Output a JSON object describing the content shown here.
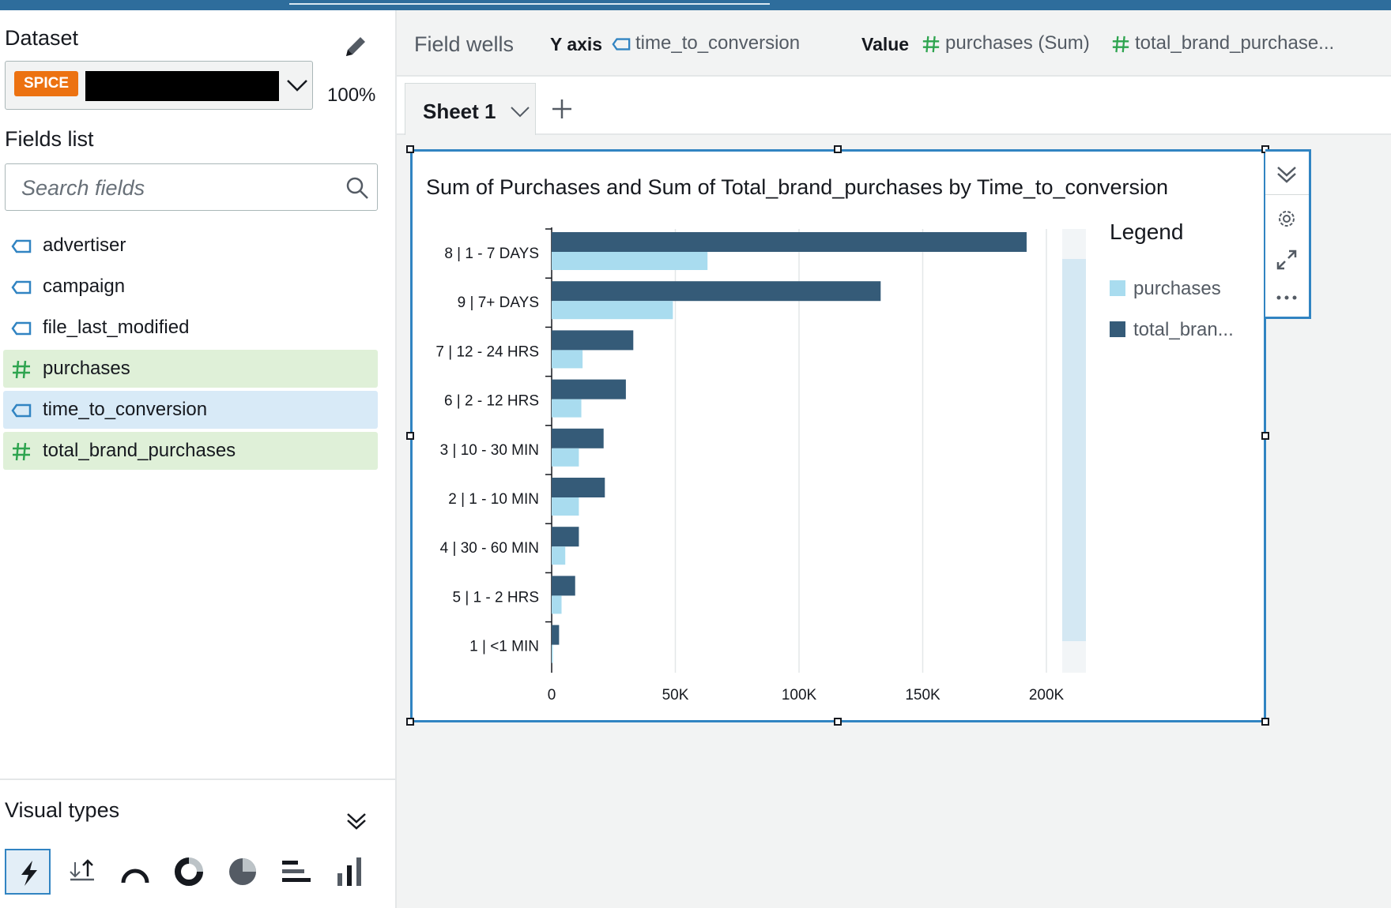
{
  "left": {
    "dataset_title": "Dataset",
    "dataset_badge": "SPICE",
    "dataset_percent": "100%",
    "fields_title": "Fields list",
    "search_placeholder": "Search fields",
    "fields": [
      {
        "label": "advertiser",
        "kind": "dimension"
      },
      {
        "label": "campaign",
        "kind": "dimension"
      },
      {
        "label": "file_last_modified",
        "kind": "dimension"
      },
      {
        "label": "purchases",
        "kind": "measure"
      },
      {
        "label": "time_to_conversion",
        "kind": "dimension-selected"
      },
      {
        "label": "total_brand_purchases",
        "kind": "measure"
      }
    ],
    "visual_types_title": "Visual types",
    "visual_type_icons": [
      "autograph-icon",
      "kpi-icon",
      "gauge-icon",
      "donut-icon",
      "pie-icon",
      "horizontal-bar-icon",
      "vertical-bar-icon"
    ]
  },
  "wells": {
    "title": "Field wells",
    "y_axis_label": "Y axis",
    "y_axis_field": "time_to_conversion",
    "value_label": "Value",
    "value_field_1": "purchases (Sum)",
    "value_field_2": "total_brand_purchase..."
  },
  "sheet": {
    "tab_label": "Sheet 1"
  },
  "colors": {
    "accent": "#3184c2",
    "purchases": "#a9dcef",
    "total_brand": "#355b78",
    "measure_green": "#2ea44f",
    "dimension_blue": "#3184c2",
    "badge_orange": "#ec7211"
  },
  "legend": {
    "title": "Legend",
    "items": [
      "purchases",
      "total_bran..."
    ]
  },
  "chart_data": {
    "type": "bar",
    "orientation": "horizontal",
    "title": "Sum of Purchases and Sum of Total_brand_purchases by Time_to_conversion",
    "categories": [
      "8 | 1 - 7 DAYS",
      "9 | 7+ DAYS",
      "7 | 12 - 24 HRS",
      "6 | 2 - 12 HRS",
      "3 | 10 - 30 MIN",
      "2 | 1 - 10 MIN",
      "4 | 30 - 60 MIN",
      "5 | 1 - 2 HRS",
      "1 | <1 MIN"
    ],
    "series": [
      {
        "name": "total_brand_purchases",
        "values": [
          192000,
          133000,
          33000,
          30000,
          21000,
          21500,
          11000,
          9500,
          3000
        ]
      },
      {
        "name": "purchases",
        "values": [
          63000,
          49000,
          12500,
          12000,
          11000,
          11000,
          5500,
          4000,
          500
        ]
      }
    ],
    "x_ticks": [
      0,
      50000,
      100000,
      150000,
      200000
    ],
    "x_tick_labels": [
      "0",
      "50K",
      "100K",
      "150K",
      "200K"
    ],
    "xlim": [
      0,
      200000
    ],
    "grid": true,
    "legend_position": "right"
  }
}
